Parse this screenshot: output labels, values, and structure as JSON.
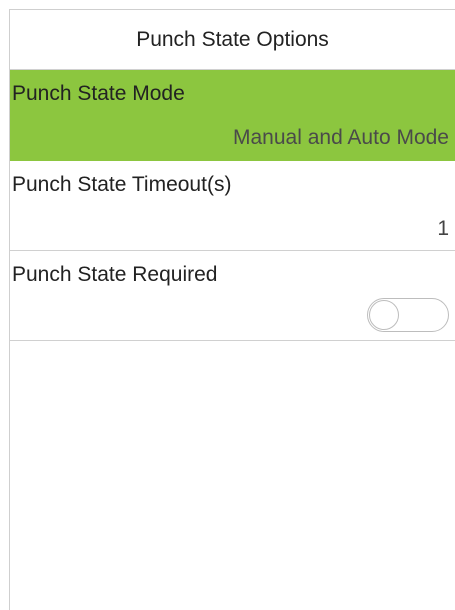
{
  "header": {
    "title": "Punch State Options"
  },
  "menu": {
    "items": [
      {
        "label": "Punch State Mode",
        "value": "Manual and Auto Mode",
        "selected": true
      },
      {
        "label": "Punch State Timeout(s)",
        "value": "1",
        "selected": false
      },
      {
        "label": "Punch State Required",
        "toggle": false,
        "selected": false
      }
    ]
  },
  "colors": {
    "selected_background": "#8cc63f",
    "divider": "#d0d0d0",
    "background": "#ffffff"
  }
}
